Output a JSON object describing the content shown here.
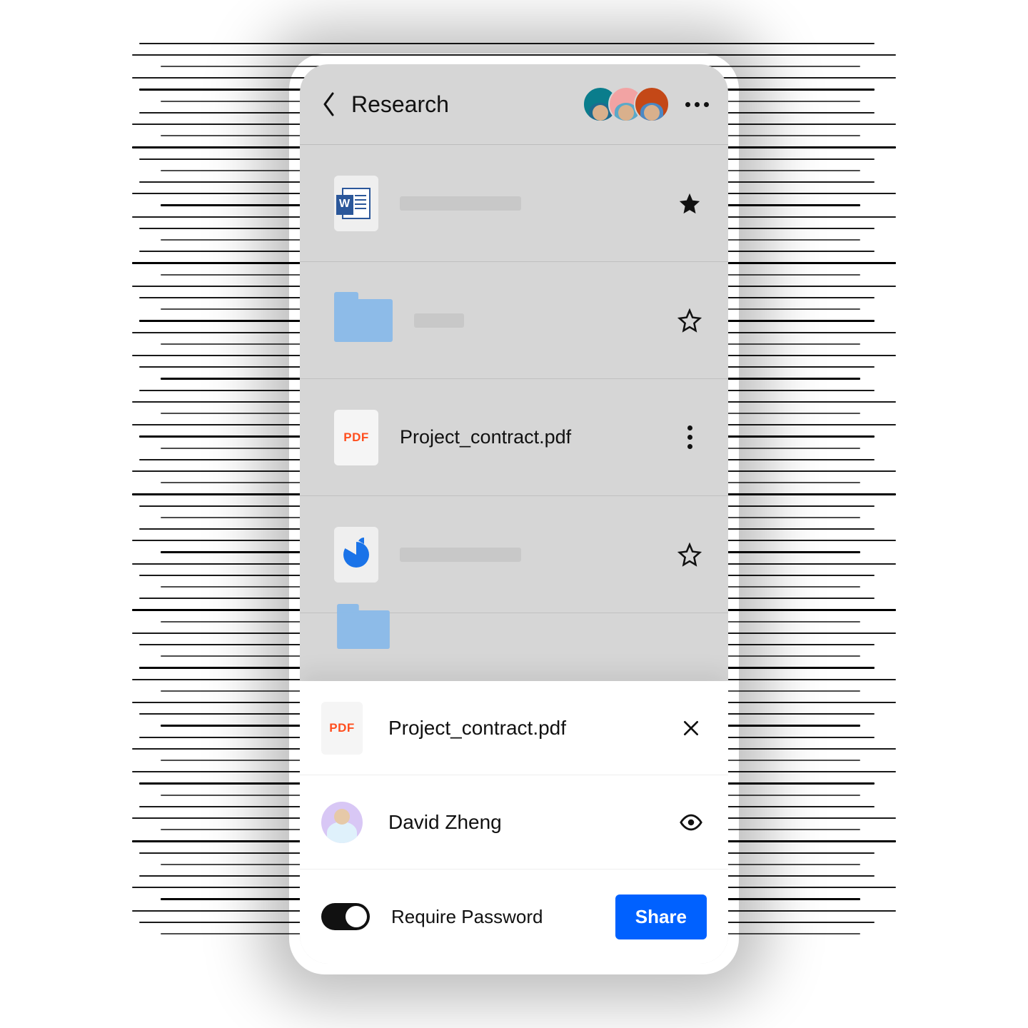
{
  "header": {
    "title": "Research",
    "collaborator_count": 3
  },
  "files": [
    {
      "type": "word",
      "name": "",
      "starred": true
    },
    {
      "type": "folder",
      "name": "",
      "starred": false
    },
    {
      "type": "pdf",
      "name": "Project_contract.pdf",
      "selected": true
    },
    {
      "type": "chart",
      "name": "",
      "starred": false
    }
  ],
  "share_sheet": {
    "file_label": "Project_contract.pdf",
    "pdf_badge": "PDF",
    "recipient": "David Zheng",
    "require_password_label": "Require Password",
    "require_password_on": true,
    "share_button": "Share"
  },
  "icons": {
    "pdf_badge": "PDF"
  }
}
